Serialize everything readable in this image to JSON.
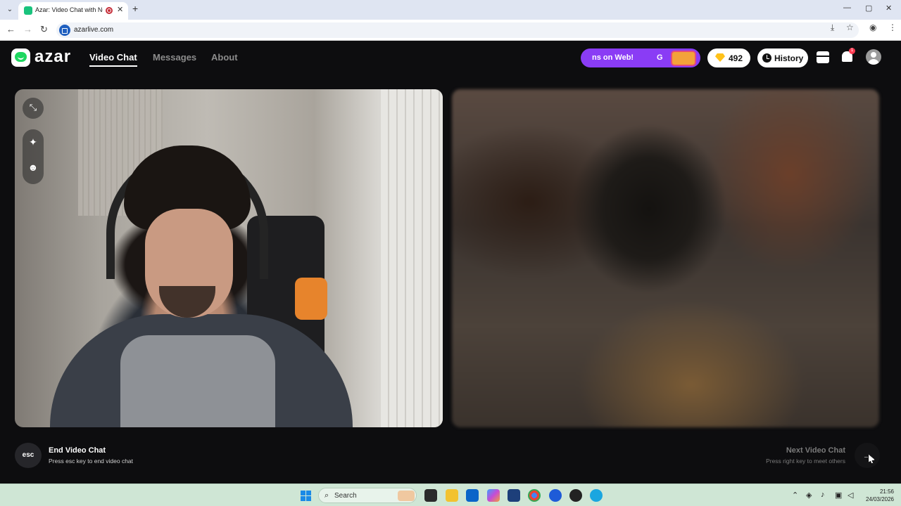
{
  "browser": {
    "tab_title": "Azar: Video Chat with New",
    "tab_close": "✕",
    "new_tab": "+",
    "url": "azarlive.com",
    "window_controls": [
      "—",
      "▢",
      "✕"
    ]
  },
  "app": {
    "logo_text": "azar",
    "nav": [
      {
        "label": "Video Chat",
        "active": true
      },
      {
        "label": "Messages",
        "active": false
      },
      {
        "label": "About",
        "active": false
      }
    ],
    "promo_text": "ns on Web!",
    "promo_letter": "G",
    "gem_count": "492",
    "history_label": "History",
    "notification_badge": "1"
  },
  "controls": {
    "esc_key": "esc",
    "end_title": "End Video Chat",
    "end_subtitle": "Press esc key to end video chat",
    "next_title": "Next Video Chat",
    "next_subtitle": "Press right key to meet others",
    "next_arrow": "→"
  },
  "taskbar": {
    "search_placeholder": "Search",
    "time": "21:56",
    "date": "24/03/2026"
  },
  "colors": {
    "brand_green": "#1ed760",
    "promo_purple": "#8a3cf5",
    "gem_gold": "#ffc21a",
    "badge_red": "#ff3b52"
  }
}
